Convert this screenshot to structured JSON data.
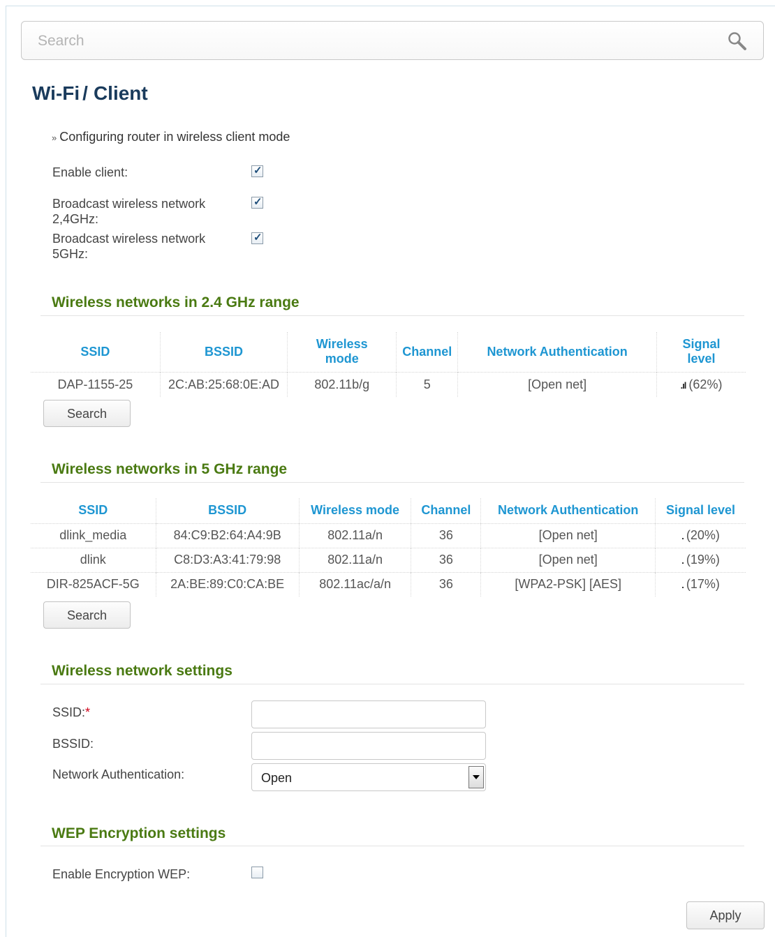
{
  "search": {
    "placeholder": "Search"
  },
  "breadcrumb": {
    "section": "Wi-Fi",
    "separator": "/",
    "page": "Client"
  },
  "description": "Configuring router in wireless client mode",
  "options": [
    {
      "label": "Enable client:",
      "checked": true
    },
    {
      "label": "Broadcast wireless network 2,4GHz:",
      "checked": true
    },
    {
      "label": "Broadcast wireless network 5GHz:",
      "checked": true
    }
  ],
  "net24": {
    "title": "Wireless networks in 2.4 GHz range",
    "columns": [
      "SSID",
      "BSSID",
      "Wireless mode",
      "Channel",
      "Network Authentication",
      "Signal level"
    ],
    "rows": [
      {
        "ssid": "DAP-1155-25",
        "bssid": "2C:AB:25:68:0E:AD",
        "mode": "802.11b/g",
        "channel": "5",
        "auth": "[Open net]",
        "signal": "(62%)"
      }
    ],
    "button": "Search"
  },
  "net5": {
    "title": "Wireless networks in 5 GHz range",
    "columns": [
      "SSID",
      "BSSID",
      "Wireless mode",
      "Channel",
      "Network Authentication",
      "Signal level"
    ],
    "rows": [
      {
        "ssid": "dlink_media",
        "bssid": "84:C9:B2:64:A4:9B",
        "mode": "802.11a/n",
        "channel": "36",
        "auth": "[Open net]",
        "signal": "(20%)"
      },
      {
        "ssid": "dlink",
        "bssid": "C8:D3:A3:41:79:98",
        "mode": "802.11a/n",
        "channel": "36",
        "auth": "[Open net]",
        "signal": "(19%)"
      },
      {
        "ssid": "DIR-825ACF-5G",
        "bssid": "2A:BE:89:C0:CA:BE",
        "mode": "802.11ac/a/n",
        "channel": "36",
        "auth": "[WPA2-PSK] [AES]",
        "signal": "(17%)"
      }
    ],
    "button": "Search"
  },
  "settings": {
    "title": "Wireless network settings",
    "ssid_label": "SSID:",
    "required_mark": "*",
    "ssid_value": "",
    "bssid_label": "BSSID:",
    "bssid_value": "",
    "auth_label": "Network Authentication:",
    "auth_value": "Open"
  },
  "wep": {
    "title": "WEP Encryption settings",
    "enable_label": "Enable Encryption WEP:",
    "enabled": false
  },
  "apply_label": "Apply"
}
